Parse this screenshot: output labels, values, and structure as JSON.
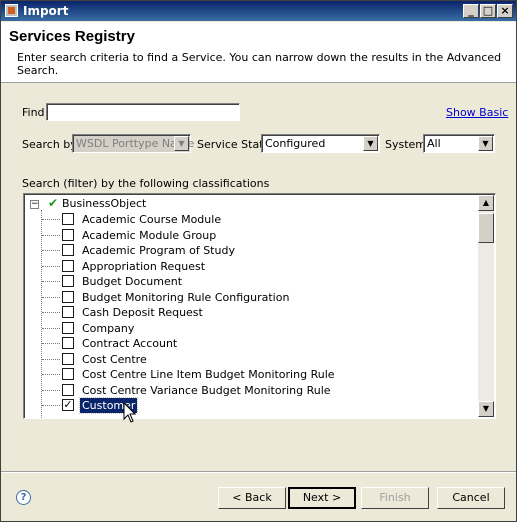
{
  "window": {
    "title": "Import"
  },
  "header": {
    "title": "Services Registry",
    "description": "Enter search criteria to find a Service. You can narrow down the results in the Advanced Search."
  },
  "search": {
    "find_label": "Find",
    "find_value": "",
    "show_basic_link": "Show Basic",
    "search_by_label": "Search by",
    "search_by_value": "WSDL Porttype Name",
    "service_state_label": "Service State",
    "service_state_value": "Configured",
    "system_label": "System",
    "system_value": "All"
  },
  "classifications": {
    "label": "Search (filter) by the following classifications",
    "root": "BusinessObject",
    "items": [
      {
        "label": "Academic Course Module",
        "checked": false
      },
      {
        "label": "Academic Module Group",
        "checked": false
      },
      {
        "label": "Academic Program of Study",
        "checked": false
      },
      {
        "label": "Appropriation Request",
        "checked": false
      },
      {
        "label": "Budget Document",
        "checked": false
      },
      {
        "label": "Budget Monitoring Rule Configuration",
        "checked": false
      },
      {
        "label": "Cash Deposit Request",
        "checked": false
      },
      {
        "label": "Company",
        "checked": false
      },
      {
        "label": "Contract Account",
        "checked": false
      },
      {
        "label": "Cost Centre",
        "checked": false
      },
      {
        "label": "Cost Centre Line Item Budget Monitoring Rule",
        "checked": false
      },
      {
        "label": "Cost Centre Variance Budget Monitoring Rule",
        "checked": false
      },
      {
        "label": "Customer",
        "checked": true,
        "selected": true
      }
    ]
  },
  "buttons": {
    "help": "?",
    "back": "< Back",
    "next": "Next >",
    "finish": "Finish",
    "cancel": "Cancel"
  },
  "icons": {
    "minimize": "_",
    "maximize": "□",
    "close": "×",
    "expander": "−",
    "root_check": "✔",
    "checkmark": "✓",
    "dropdown_arrow": "▼",
    "scroll_up": "▲",
    "scroll_down": "▼"
  }
}
